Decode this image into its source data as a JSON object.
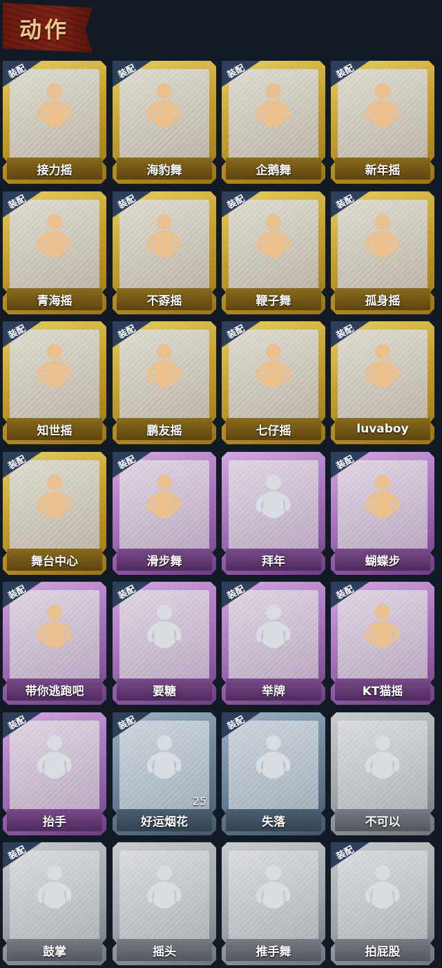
{
  "header": {
    "title": "动作"
  },
  "equip_label": "装配",
  "colors": {
    "gold": "#c6a02e",
    "purple": "#a470b9",
    "blue": "#6c8498",
    "grey": "#9ea3a9",
    "figure_gold": "#e9c08e",
    "figure_white": "#d8dde2"
  },
  "cards": [
    {
      "name": "接力摇",
      "rarity": "gold",
      "equipped": true,
      "icon": "dance-figure-icon"
    },
    {
      "name": "海豹舞",
      "rarity": "gold",
      "equipped": true,
      "icon": "dance-figure-icon"
    },
    {
      "name": "企鹅舞",
      "rarity": "gold",
      "equipped": true,
      "icon": "dance-figure-icon"
    },
    {
      "name": "新年摇",
      "rarity": "gold",
      "equipped": true,
      "icon": "dance-figure-icon"
    },
    {
      "name": "青海摇",
      "rarity": "gold",
      "equipped": true,
      "icon": "dance-figure-icon"
    },
    {
      "name": "不孬摇",
      "rarity": "gold",
      "equipped": true,
      "icon": "dance-figure-icon"
    },
    {
      "name": "鞭子舞",
      "rarity": "gold",
      "equipped": true,
      "icon": "dance-figure-icon"
    },
    {
      "name": "孤身摇",
      "rarity": "gold",
      "equipped": true,
      "icon": "dance-figure-icon"
    },
    {
      "name": "知世摇",
      "rarity": "gold",
      "equipped": true,
      "icon": "dance-figure-icon"
    },
    {
      "name": "鹏友摇",
      "rarity": "gold",
      "equipped": true,
      "icon": "dance-figure-icon"
    },
    {
      "name": "七仔摇",
      "rarity": "gold",
      "equipped": true,
      "icon": "dance-figure-icon"
    },
    {
      "name": "luvaboy",
      "rarity": "gold",
      "equipped": true,
      "icon": "dance-figure-icon"
    },
    {
      "name": "舞台中心",
      "rarity": "gold",
      "equipped": true,
      "icon": "dance-figure-icon"
    },
    {
      "name": "滑步舞",
      "rarity": "purple",
      "equipped": true,
      "icon": "dance-figure-icon"
    },
    {
      "name": "拜年",
      "rarity": "purple",
      "equipped": false,
      "icon": "bow-figure-icon"
    },
    {
      "name": "蝴蝶步",
      "rarity": "purple",
      "equipped": true,
      "icon": "dance-figure-icon"
    },
    {
      "name": "带你逃跑吧",
      "rarity": "purple",
      "equipped": true,
      "icon": "dance-figure-icon"
    },
    {
      "name": "要糖",
      "rarity": "purple",
      "equipped": true,
      "icon": "beg-figure-icon"
    },
    {
      "name": "举牌",
      "rarity": "purple",
      "equipped": true,
      "icon": "sign-figure-icon"
    },
    {
      "name": "KT猫摇",
      "rarity": "purple",
      "equipped": true,
      "icon": "dance-figure-icon"
    },
    {
      "name": "抬手",
      "rarity": "purple",
      "equipped": true,
      "icon": "raise-hand-figure-icon"
    },
    {
      "name": "好运烟花",
      "rarity": "blue",
      "equipped": true,
      "icon": "firework-icon",
      "count": "25"
    },
    {
      "name": "失落",
      "rarity": "blue",
      "equipped": true,
      "icon": "crawl-figure-icon"
    },
    {
      "name": "不可以",
      "rarity": "grey",
      "equipped": false,
      "icon": "wag-finger-icon"
    },
    {
      "name": "鼓掌",
      "rarity": "grey",
      "equipped": true,
      "icon": "clap-icon"
    },
    {
      "name": "摇头",
      "rarity": "grey",
      "equipped": false,
      "icon": "shake-head-figure-icon"
    },
    {
      "name": "推手舞",
      "rarity": "grey",
      "equipped": false,
      "icon": "push-figure-icon"
    },
    {
      "name": "拍屁股",
      "rarity": "grey",
      "equipped": true,
      "icon": "pat-figure-icon"
    }
  ]
}
